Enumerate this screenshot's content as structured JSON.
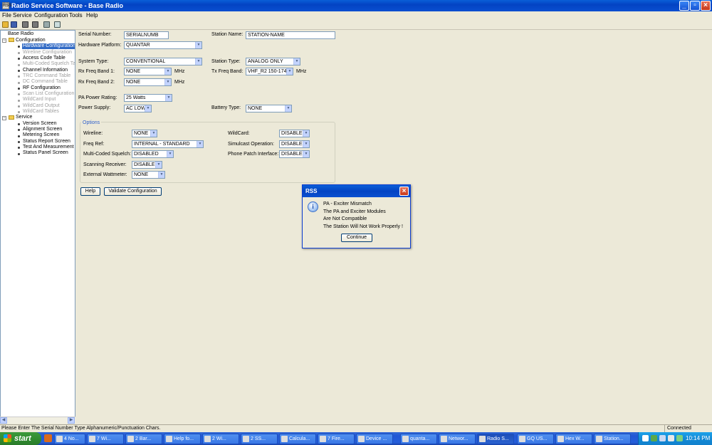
{
  "window": {
    "title": "Radio Service Software - Base Radio",
    "app_icon": "RSS"
  },
  "menu": [
    "File",
    "Service",
    "Configuration",
    "Tools",
    "Help"
  ],
  "toolbar_icons": [
    "open-icon",
    "save-icon",
    "read-radio-icon",
    "write-radio-icon",
    "tools-icon",
    "help-pointer-icon"
  ],
  "tree": {
    "root": "Base Radio",
    "configuration": {
      "label": "Configuration",
      "items": [
        {
          "label": "Hardware Configuration",
          "state": "selected"
        },
        {
          "label": "Wireline Configuration",
          "state": "disabled"
        },
        {
          "label": "Access Code Table",
          "state": "enabled"
        },
        {
          "label": "Multi-Coded Squelch Tal",
          "state": "disabled"
        },
        {
          "label": "Channel Information",
          "state": "enabled"
        },
        {
          "label": "TRC Command Table",
          "state": "disabled"
        },
        {
          "label": "DC Command Table",
          "state": "disabled"
        },
        {
          "label": "RF Configuration",
          "state": "enabled"
        },
        {
          "label": "Scan List Configuration",
          "state": "disabled"
        },
        {
          "label": "WildCard Input",
          "state": "disabled"
        },
        {
          "label": "WildCard Output",
          "state": "disabled"
        },
        {
          "label": "WildCard Tables",
          "state": "disabled"
        }
      ]
    },
    "service": {
      "label": "Service",
      "items": [
        {
          "label": "Version Screen",
          "state": "enabled"
        },
        {
          "label": "Alignment Screen",
          "state": "enabled"
        },
        {
          "label": "Metering Screen",
          "state": "enabled"
        },
        {
          "label": "Status Report Screen",
          "state": "enabled"
        },
        {
          "label": "Test And Measurement S",
          "state": "enabled"
        },
        {
          "label": "Status Panel Screen",
          "state": "enabled"
        }
      ]
    }
  },
  "form": {
    "serial_number": {
      "label": "Serial Number:",
      "value": "SERIALNUMB"
    },
    "station_name": {
      "label": "Station Name:",
      "value": "STATION-NAME"
    },
    "hardware_platform": {
      "label": "Hardware Platform:",
      "value": "QUANTAR"
    },
    "system_type": {
      "label": "System Type:",
      "value": "CONVENTIONAL"
    },
    "station_type": {
      "label": "Station Type:",
      "value": "ANALOG ONLY"
    },
    "rx_freq_band_1": {
      "label": "Rx Freq Band 1:",
      "value": "NONE",
      "unit": "MHz"
    },
    "tx_freq_band": {
      "label": "Tx Freq Band:",
      "value": "VHF_R2  150-174",
      "unit": "MHz"
    },
    "rx_freq_band_2": {
      "label": "Rx Freq Band 2:",
      "value": "NONE",
      "unit": "MHz"
    },
    "pa_power_rating": {
      "label": "PA Power Rating:",
      "value": "25  Watts"
    },
    "power_supply": {
      "label": "Power Supply:",
      "value": "AC LOW"
    },
    "battery_type": {
      "label": "Battery Type:",
      "value": "NONE"
    }
  },
  "options": {
    "legend": "Options",
    "wireline": {
      "label": "Wireline:",
      "value": "NONE"
    },
    "wildcard": {
      "label": "WildCard:",
      "value": "DISABLED"
    },
    "freq_ref": {
      "label": "Freq Ref:",
      "value": "INTERNAL - STANDARD"
    },
    "simulcast": {
      "label": "Simulcast Operation:",
      "value": "DISABLED"
    },
    "mcs": {
      "label": "Multi-Coded Squelch:",
      "value": "DISABLED"
    },
    "phone_patch": {
      "label": "Phone Patch Interface:",
      "value": "DISABLED"
    },
    "scanning": {
      "label": "Scanning Receiver:",
      "value": "DISABLED"
    },
    "wattmeter": {
      "label": "External Wattmeter:",
      "value": "NONE"
    }
  },
  "buttons": {
    "help": "Help",
    "validate": "Validate Configuration"
  },
  "dialog": {
    "title": "RSS",
    "icon": "info-icon",
    "lines": [
      "PA - Exciter Mismatch",
      "The PA and Exciter Modules",
      "Are Not Compatible",
      "The Station Will Not Work Properly !"
    ],
    "button": "Continue"
  },
  "status": {
    "message": "Please Enter The Serial Number Type Alphanumeric/Punctuation Chars.",
    "connection": "Connected"
  },
  "taskbar": {
    "start": "start",
    "buttons": [
      "4 No...",
      "7 Wi...",
      "2 Bar...",
      "Help fo...",
      "2 Wi...",
      "2 SS...",
      "Calcula...",
      "7 Fire...",
      "Device ...",
      "quanta...",
      "Networ...",
      "Radio S...",
      "GQ US...",
      "Hex W...",
      "Station..."
    ],
    "active": "Radio S...",
    "clock": "10:14 PM"
  }
}
